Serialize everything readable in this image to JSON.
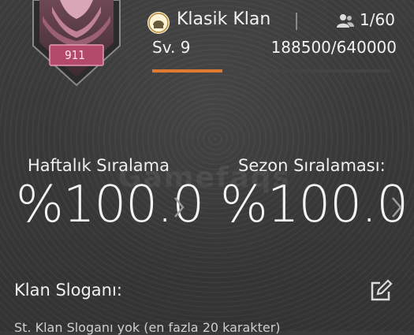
{
  "clan": {
    "name": "Klasik Klan",
    "emblem_level": "911",
    "level_label": "Sv. 9",
    "xp_text": "188500/640000",
    "xp_progress": 0.2945,
    "members": "1/60"
  },
  "rankings": {
    "weekly_label": "Haftalık Sıralama",
    "weekly_value": "%100.0",
    "season_label": "Sezon Sıralaması:",
    "season_value": "%100.0"
  },
  "watermark": "Gamefaqs",
  "slogan": {
    "label": "Klan Sloganı:",
    "text": "St. Klan Sloganı yok (en fazla 20 karakter)"
  },
  "colors": {
    "accent": "#e07a2e",
    "emblem": "#c97a94",
    "background": "#3a3a3a"
  },
  "icons": {
    "clan_icon": "laurel-helmet-icon",
    "members_icon": "people-icon",
    "chevron": "chevron-right-icon",
    "edit": "edit-icon"
  }
}
